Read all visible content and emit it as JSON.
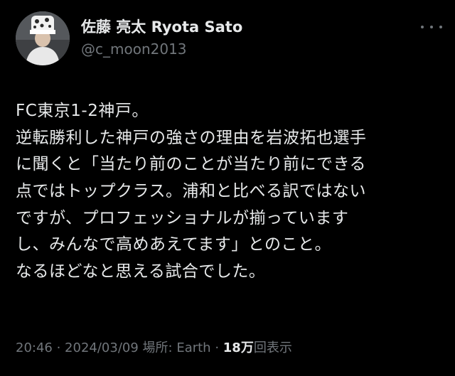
{
  "author": {
    "display_name": "佐藤 亮太  Ryota Sato",
    "handle": "@c_moon2013"
  },
  "tweet": {
    "lines": [
      "FC東京1-2神戸。",
      "逆転勝利した神戸の強さの理由を岩波拓也選手",
      "に聞くと「当たり前のことが当たり前にできる",
      "点ではトップクラス。浦和と比べる訳ではない",
      "ですが、プロフェッショナルが揃っています",
      "し、みんなで高めあえてます」とのこと。",
      "なるほどなと思える試合でした。"
    ]
  },
  "meta": {
    "time": "20:46",
    "separator": " · ",
    "date": "2024/03/09",
    "location": "場所: Earth",
    "views_count": "18万",
    "views_label": "回表示"
  },
  "colors": {
    "background": "#000000",
    "primary_text": "#e7e9ea",
    "secondary_text": "#71767b"
  },
  "icons": {
    "more": "more-horizontal-icon",
    "avatar": "avatar-photo"
  }
}
